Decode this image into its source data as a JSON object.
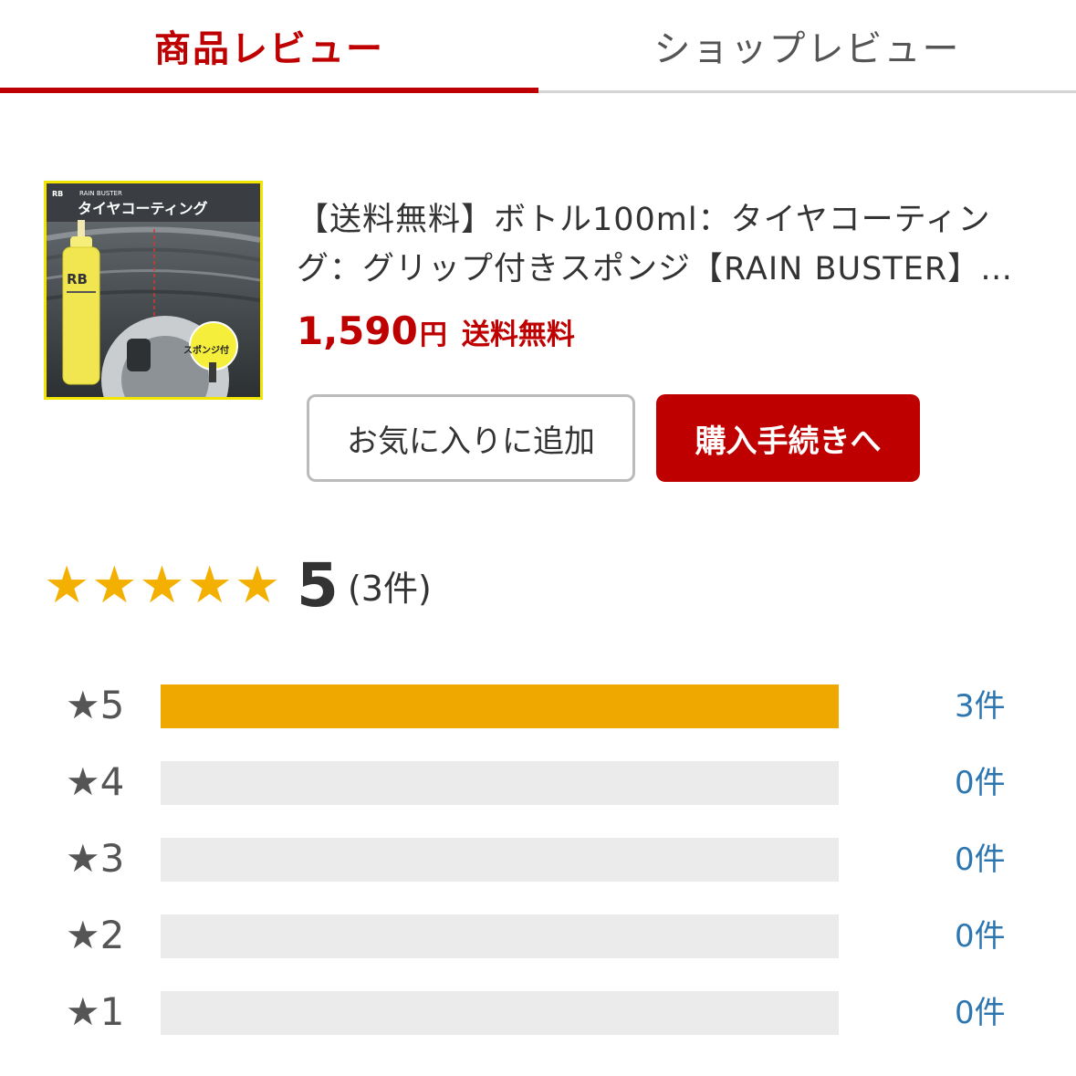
{
  "tabs": {
    "product_review": "商品レビュー",
    "shop_review": "ショップレビュー"
  },
  "product": {
    "image": {
      "brand_caption": "RAIN BUSTER",
      "title_text": "タイヤコーティング",
      "logo_text": "RB",
      "sticker_text": "スポンジ付"
    },
    "title": "【送料無料】ボトル100ml：タイヤコーティング：グリップ付きスポンジ【RAIN BUSTER】…",
    "price": "1,590",
    "currency": "円",
    "shipping": "送料無料",
    "favorite_button": "お気に入りに追加",
    "buy_button": "購入手続きへ"
  },
  "summary": {
    "stars": "★★★★★",
    "average": "5",
    "count": "(3件)"
  },
  "distribution": [
    {
      "label": "★5",
      "count": "3件",
      "fraction": 1.0
    },
    {
      "label": "★4",
      "count": "0件",
      "fraction": 0
    },
    {
      "label": "★3",
      "count": "0件",
      "fraction": 0
    },
    {
      "label": "★2",
      "count": "0件",
      "fraction": 0
    },
    {
      "label": "★1",
      "count": "0件",
      "fraction": 0
    }
  ],
  "colors": {
    "accent": "#bf0000",
    "star": "#f3b000",
    "bar_fill": "#efa800",
    "bar_track": "#ebebeb",
    "link": "#2d76b0"
  }
}
